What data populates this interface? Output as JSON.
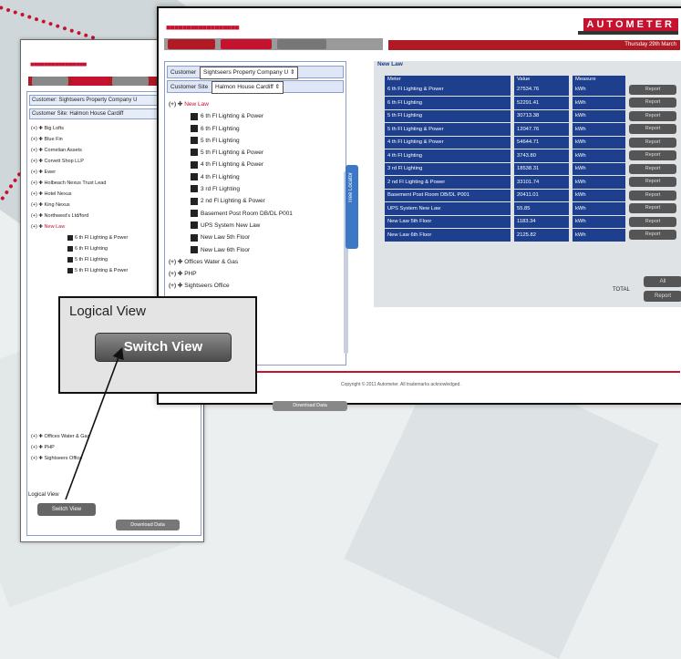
{
  "front": {
    "brand": "AUTOMETER",
    "date_text": "Thursday 29th March",
    "customer_label": "Customer",
    "customer_value": "Sightseers Property Company U",
    "site_label": "Customer Site",
    "site_value": "Halmon House Cardiff",
    "tree": [
      {
        "label": "New Law",
        "red": true,
        "level": 0
      },
      {
        "label": "6 th Fl Lighting & Power",
        "level": 1
      },
      {
        "label": "6 th Fl Lighting",
        "level": 1
      },
      {
        "label": "5 th Fl Lighting",
        "level": 1
      },
      {
        "label": "5 th Fl Lighting & Power",
        "level": 1
      },
      {
        "label": "4 th Fl Lighting & Power",
        "level": 1
      },
      {
        "label": "4 th Fl Lighting",
        "level": 1
      },
      {
        "label": "3 rd Fl Lighting",
        "level": 1
      },
      {
        "label": "2 nd Fl Lighting & Power",
        "level": 1
      },
      {
        "label": "Basement Post Room DB/DL P001",
        "level": 1
      },
      {
        "label": "UPS System New Law",
        "level": 1
      },
      {
        "label": "New Law 5th Floor",
        "level": 1
      },
      {
        "label": "New Law 6th Floor",
        "level": 1
      },
      {
        "label": "Offices Water & Gas",
        "level": 0
      },
      {
        "label": "PHP",
        "level": 0
      },
      {
        "label": "Sightseers Office",
        "level": 0
      }
    ],
    "tab_handle": "Tree Locator",
    "left_bottom_button": "Download Data",
    "main_title": "New Law",
    "table_headers": [
      "Meter",
      "Value",
      "Measure",
      ""
    ],
    "rows": [
      {
        "meter": "6 th Fl Lighting & Power",
        "value": "27534.76",
        "measure": "kWh"
      },
      {
        "meter": "6 th Fl Lighting",
        "value": "52291.41",
        "measure": "kWh"
      },
      {
        "meter": "5 th Fl Lighting",
        "value": "30713.38",
        "measure": "kWh"
      },
      {
        "meter": "5 th Fl Lighting & Power",
        "value": "12047.76",
        "measure": "kWh"
      },
      {
        "meter": "4 th Fl Lighting & Power",
        "value": "54644.71",
        "measure": "kWh"
      },
      {
        "meter": "4 th Fl Lighting",
        "value": "3743.80",
        "measure": "kWh"
      },
      {
        "meter": "3 rd Fl Lighting",
        "value": "18538.31",
        "measure": "kWh"
      },
      {
        "meter": "2 nd Fl Lighting & Power",
        "value": "33101.74",
        "measure": "kWh"
      },
      {
        "meter": "Basement Post Room DB/DL P001",
        "value": "20411.01",
        "measure": "kWh"
      },
      {
        "meter": "UPS System New Law",
        "value": "55.85",
        "measure": "kWh"
      },
      {
        "meter": "New Law 5th Floor",
        "value": "1183.34",
        "measure": "kWh"
      },
      {
        "meter": "New Law 6th Floor",
        "value": "2125.82",
        "measure": "kWh"
      }
    ],
    "row_button": "Report",
    "total_label": "TOTAL",
    "all_button": "All",
    "all_report_button": "Report",
    "copyright": "Copyright © 2011 Autometer. All trademarks acknowledged."
  },
  "back": {
    "customer_label": "Customer",
    "customer_value": "Sightseers Property Company U",
    "site_label": "Customer Site",
    "site_value": "Halmon House Cardiff",
    "tree": [
      {
        "label": "Big Lofts"
      },
      {
        "label": "Blue Fin"
      },
      {
        "label": "Cornelian Assets"
      },
      {
        "label": "Corvett Shop LLP"
      },
      {
        "label": "Ewer"
      },
      {
        "label": "Holbeach Nexus Trust Lead"
      },
      {
        "label": "Hotel Nexus"
      },
      {
        "label": "King Nexus"
      },
      {
        "label": "Northwest's Ltd/ford"
      },
      {
        "label": "New Law",
        "red": true
      },
      {
        "label": "6 th Fl Lighting & Power",
        "sub": true
      },
      {
        "label": "6 th Fl Lighting",
        "sub": true
      },
      {
        "label": "5 th Fl Lighting",
        "sub": true
      },
      {
        "label": "5 th Fl Lighting & Power",
        "sub": true
      }
    ],
    "tree_bottom": [
      {
        "label": "Offices Water & Gas"
      },
      {
        "label": "PHP"
      },
      {
        "label": "Sightseers Office"
      }
    ],
    "logical_label": "Logical View",
    "switch_button": "Switch View",
    "download_button": "Download Data"
  },
  "callout": {
    "title": "Logical View",
    "button": "Switch View"
  }
}
